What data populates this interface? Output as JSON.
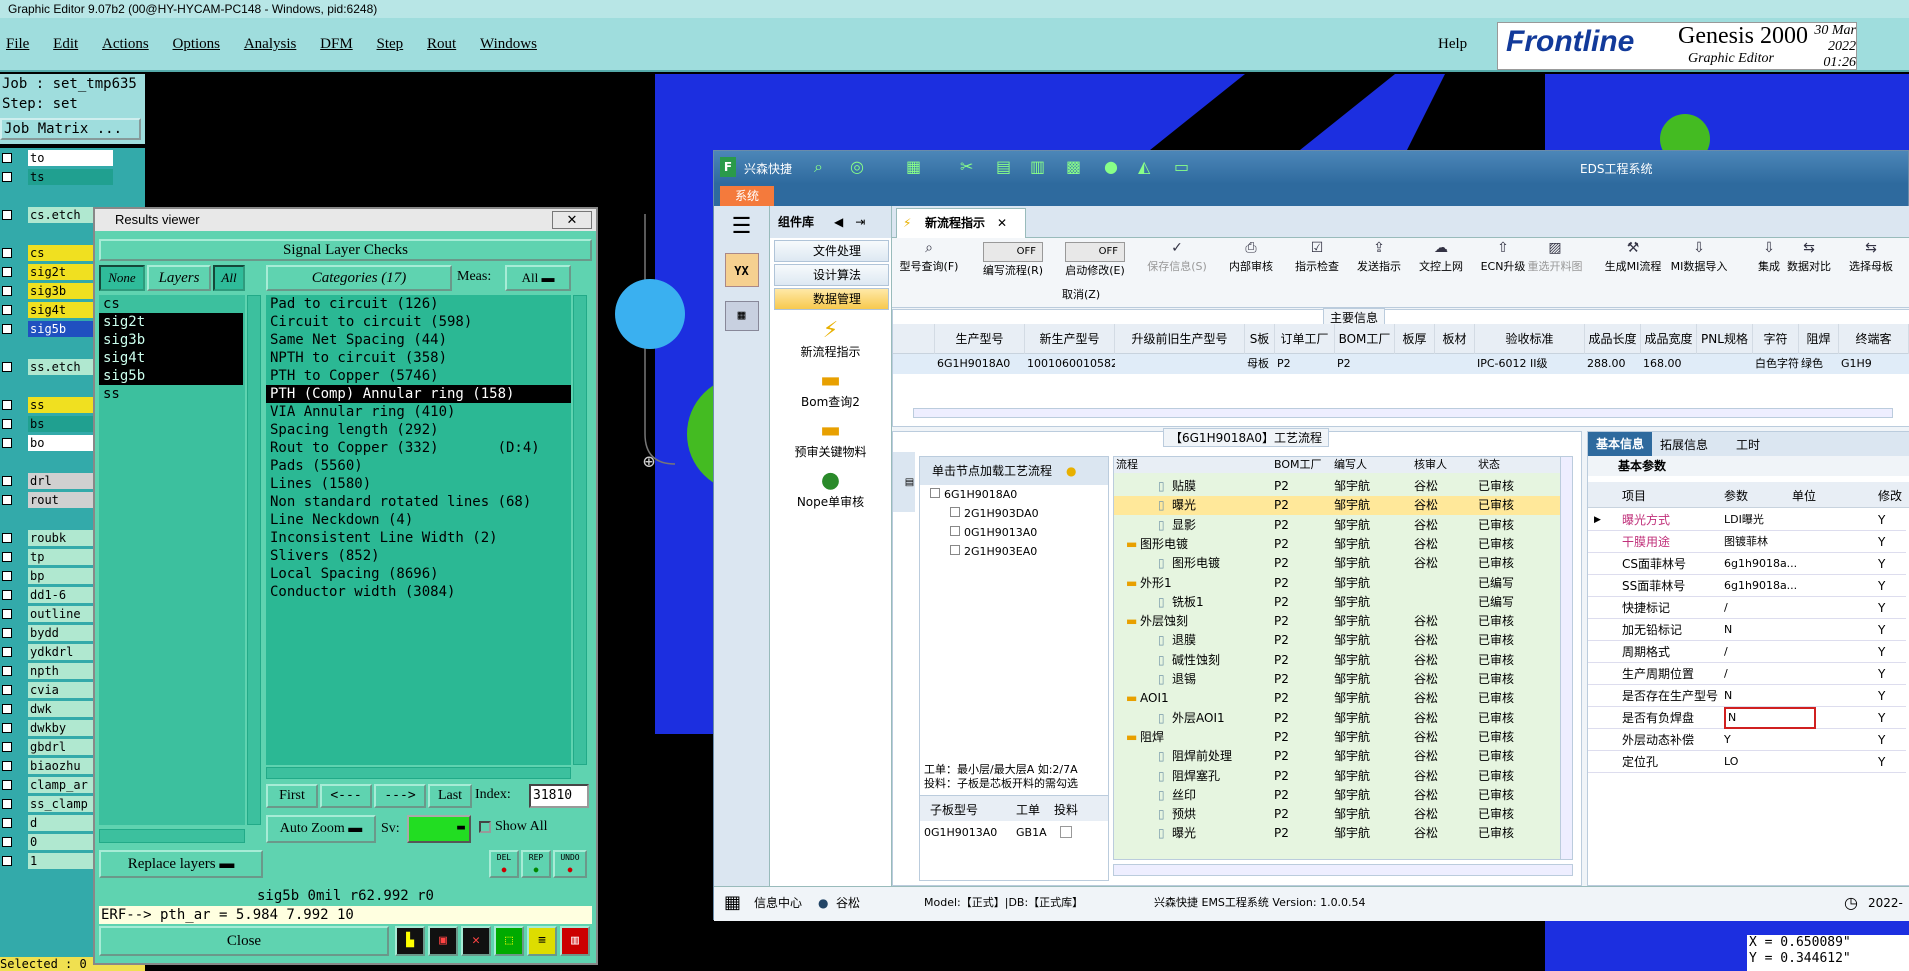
{
  "window_title": "Graphic Editor 9.07b2 (00@HY-HYCAM-PC148 - Windows, pid:6248)",
  "menu": [
    "File",
    "Edit",
    "Actions",
    "Options",
    "Analysis",
    "DFM",
    "Step",
    "Rout",
    "Windows"
  ],
  "help": "Help",
  "brand": {
    "logo": "Frontline",
    "product": "Genesis 2000",
    "subtitle": "Graphic Editor",
    "date": "30 Mar 2022",
    "time": "01:26 PM"
  },
  "job": {
    "job_line": "Job : set_tmp635",
    "step_line": "Step: set",
    "matrix_btn": "Job Matrix ..."
  },
  "layers": [
    {
      "name": "to",
      "bg": "#ffffff"
    },
    {
      "name": "ts",
      "bg": "#20a090"
    },
    {
      "name": "",
      "bg": ""
    },
    {
      "name": "cs.etch",
      "bg": "#b0e8d0"
    },
    {
      "name": "",
      "bg": ""
    },
    {
      "name": "cs",
      "bg": "#f0e020"
    },
    {
      "name": "sig2t",
      "bg": "#f0e020"
    },
    {
      "name": "sig3b",
      "bg": "#f0e020"
    },
    {
      "name": "sig4t",
      "bg": "#f0e020"
    },
    {
      "name": "sig5b",
      "bg": "#2050c0"
    },
    {
      "name": "",
      "bg": ""
    },
    {
      "name": "ss.etch",
      "bg": "#b0e8d0"
    },
    {
      "name": "",
      "bg": ""
    },
    {
      "name": "ss",
      "bg": "#f0e020"
    },
    {
      "name": "bs",
      "bg": "#20a090"
    },
    {
      "name": "bo",
      "bg": "#ffffff"
    },
    {
      "name": "",
      "bg": ""
    },
    {
      "name": "drl",
      "bg": "#d0d0d0"
    },
    {
      "name": "rout",
      "bg": "#d0d0d0"
    },
    {
      "name": "",
      "bg": ""
    },
    {
      "name": "roubk",
      "bg": "#b0e8d0"
    },
    {
      "name": "tp",
      "bg": "#b0e8d0"
    },
    {
      "name": "bp",
      "bg": "#b0e8d0"
    },
    {
      "name": "dd1-6",
      "bg": "#b0e8d0"
    },
    {
      "name": "outline",
      "bg": "#b0e8d0"
    },
    {
      "name": "bydd",
      "bg": "#b0e8d0"
    },
    {
      "name": "ydkdrl",
      "bg": "#b0e8d0"
    },
    {
      "name": "npth",
      "bg": "#b0e8d0"
    },
    {
      "name": "cvia",
      "bg": "#b0e8d0"
    },
    {
      "name": "dwk",
      "bg": "#b0e8d0"
    },
    {
      "name": "dwkby",
      "bg": "#b0e8d0"
    },
    {
      "name": "gbdrl",
      "bg": "#b0e8d0"
    },
    {
      "name": "biaozhu",
      "bg": "#b0e8d0"
    },
    {
      "name": "clamp_ar",
      "bg": "#b0e8d0"
    },
    {
      "name": "ss_clamp",
      "bg": "#b0e8d0"
    },
    {
      "name": "d",
      "bg": "#b0e8d0"
    },
    {
      "name": "0",
      "bg": "#b0e8d0"
    },
    {
      "name": "1",
      "bg": "#b0e8d0"
    }
  ],
  "selected_label": "Selected : 0",
  "results_viewer": {
    "title": "Results viewer",
    "heading": "Signal Layer Checks",
    "none_btn": "None",
    "layers_btn": "Layers",
    "all_btn": "All",
    "categories_btn": "Categories (17)",
    "meas_label": "Meas:",
    "meas_value": "All",
    "layer_items": [
      "cs",
      "sig2t",
      "sig3b",
      "sig4t",
      "sig5b",
      "ss"
    ],
    "categories": [
      "Pad to circuit (126)",
      "Circuit to circuit (598)",
      "Same Net Spacing (44)",
      "NPTH to circuit (358)",
      "PTH to Copper (5746)",
      "PTH (Comp) Annular ring (158)",
      "VIA Annular ring (410)",
      "Spacing length (292)",
      "Rout to Copper (332)       (D:4)",
      "Pads (5560)",
      "Lines (1580)",
      "Non standard rotated lines (68)",
      "Line Neckdown (4)",
      "Inconsistent Line Width (2)",
      "Slivers (852)",
      "Local Spacing (8696)",
      "Conductor width (3084)"
    ],
    "first": "First",
    "prev": "<---",
    "next": "--->",
    "last": "Last",
    "index_label": "Index:",
    "index_value": "31810",
    "auto_zoom": "Auto Zoom",
    "sv_label": "Sv:",
    "show_all": "Show All",
    "replace_layers": "Replace layers",
    "icon_labels": [
      "DEL",
      "REP",
      "UNDO"
    ],
    "bottom_text": "sig5b 0mil  r62.992  r0",
    "erf_text": "ERF--> pth_ar = 5.984 7.992 10",
    "close": "Close"
  },
  "eds": {
    "app_name": "兴森快捷",
    "window_title": "EDS工程系统",
    "system_tab": "系统",
    "comp_lib": "组件库",
    "comp_buttons": [
      "文件处理",
      "设计算法",
      "数据管理"
    ],
    "comp_tools": [
      "新流程指示",
      "Bom查询2",
      "预审关键物料",
      "Nope单审核"
    ],
    "active_tab": "新流程指示",
    "toolbar": [
      "型号查询(F)",
      "编写流程(R)",
      "启动修改(E)",
      "保存信息(S)",
      "内部审核",
      "指示检查",
      "发送指示",
      "文控上网",
      "ECN升级",
      "重选开料图",
      "生成MI流程",
      "MI数据导入",
      "集成",
      "数据对比",
      "选择母板"
    ],
    "toggle_off": "OFF",
    "cancel_label": "取消(Z)",
    "main_info_label": "主要信息",
    "main_cols": [
      "生产型号",
      "新生产型号",
      "升级前旧生产型号",
      "S板",
      "订单工厂",
      "BOM工厂",
      "板厚",
      "板材",
      "验收标准",
      "成品长度",
      "成品宽度",
      "PNL规格",
      "字符",
      "阻焊",
      "终端客"
    ],
    "main_row": [
      "6G1H9018A0",
      "10010600105823",
      "",
      "母板",
      "P2",
      "P2",
      "",
      "",
      "IPC-6012 II级",
      "288.00",
      "168.00",
      "",
      "白色字符",
      "绿色",
      "G1H9"
    ],
    "flow_label": "【6G1H9018A0】工艺流程",
    "node_hint": "单击节点加载工艺流程",
    "tree_nodes": [
      "6G1H9018A0",
      "2G1H903DA0",
      "0G1H9013A0",
      "2G1H903EA0"
    ],
    "work_note_1": "工单：最小层/最大层A 如:2/7A",
    "work_note_2": "投料：子板是芯板开料的需勾选",
    "sub_cols": [
      "子板型号",
      "工单",
      "投料"
    ],
    "sub_row": [
      "0G1H9013A0",
      "GB1A"
    ],
    "flow_cols": [
      "流程",
      "BOM工厂",
      "编写人",
      "核审人",
      "状态"
    ],
    "flow_rows": [
      {
        "n": "贴膜",
        "f": "P2",
        "w": "邹宇航",
        "r": "谷松",
        "s": "已审核",
        "lvl": 2
      },
      {
        "n": "曝光",
        "f": "P2",
        "w": "邹宇航",
        "r": "谷松",
        "s": "已审核",
        "lvl": 2,
        "sel": true
      },
      {
        "n": "显影",
        "f": "P2",
        "w": "邹宇航",
        "r": "谷松",
        "s": "已审核",
        "lvl": 2
      },
      {
        "n": "图形电镀",
        "f": "P2",
        "w": "邹宇航",
        "r": "谷松",
        "s": "已审核",
        "lvl": 1
      },
      {
        "n": "图形电镀",
        "f": "P2",
        "w": "邹宇航",
        "r": "谷松",
        "s": "已审核",
        "lvl": 2
      },
      {
        "n": "外形1",
        "f": "P2",
        "w": "邹宇航",
        "r": "",
        "s": "已编写",
        "lvl": 1
      },
      {
        "n": "铣板1",
        "f": "P2",
        "w": "邹宇航",
        "r": "",
        "s": "已编写",
        "lvl": 2
      },
      {
        "n": "外层蚀刻",
        "f": "P2",
        "w": "邹宇航",
        "r": "谷松",
        "s": "已审核",
        "lvl": 1
      },
      {
        "n": "退膜",
        "f": "P2",
        "w": "邹宇航",
        "r": "谷松",
        "s": "已审核",
        "lvl": 2
      },
      {
        "n": "碱性蚀刻",
        "f": "P2",
        "w": "邹宇航",
        "r": "谷松",
        "s": "已审核",
        "lvl": 2
      },
      {
        "n": "退锡",
        "f": "P2",
        "w": "邹宇航",
        "r": "谷松",
        "s": "已审核",
        "lvl": 2
      },
      {
        "n": "AOI1",
        "f": "P2",
        "w": "邹宇航",
        "r": "谷松",
        "s": "已审核",
        "lvl": 1
      },
      {
        "n": "外层AOI1",
        "f": "P2",
        "w": "邹宇航",
        "r": "谷松",
        "s": "已审核",
        "lvl": 2
      },
      {
        "n": "阻焊",
        "f": "P2",
        "w": "邹宇航",
        "r": "谷松",
        "s": "已审核",
        "lvl": 1
      },
      {
        "n": "阻焊前处理",
        "f": "P2",
        "w": "邹宇航",
        "r": "谷松",
        "s": "已审核",
        "lvl": 2
      },
      {
        "n": "阻焊塞孔",
        "f": "P2",
        "w": "邹宇航",
        "r": "谷松",
        "s": "已审核",
        "lvl": 2
      },
      {
        "n": "丝印",
        "f": "P2",
        "w": "邹宇航",
        "r": "谷松",
        "s": "已审核",
        "lvl": 2
      },
      {
        "n": "预烘",
        "f": "P2",
        "w": "邹宇航",
        "r": "谷松",
        "s": "已审核",
        "lvl": 2
      },
      {
        "n": "曝光",
        "f": "P2",
        "w": "邹宇航",
        "r": "谷松",
        "s": "已审核",
        "lvl": 2
      }
    ],
    "right_tabs": [
      "基本信息",
      "拓展信息",
      "工时"
    ],
    "basic_params": "基本参数",
    "prop_cols": [
      "项目",
      "参数",
      "单位",
      "修改"
    ],
    "props": [
      {
        "k": "曝光方式",
        "v": "LDI曝光",
        "u": "",
        "m": "Y",
        "color": "#c0307a"
      },
      {
        "k": "干膜用途",
        "v": "图镀菲林",
        "u": "",
        "m": "Y",
        "color": "#c0307a"
      },
      {
        "k": "CS面菲林号",
        "v": "6g1h9018a...",
        "u": "",
        "m": "Y",
        "color": ""
      },
      {
        "k": "SS面菲林号",
        "v": "6g1h9018a...",
        "u": "",
        "m": "Y",
        "color": ""
      },
      {
        "k": "快捷标记",
        "v": "/",
        "u": "",
        "m": "Y",
        "color": ""
      },
      {
        "k": "加无铅标记",
        "v": "N",
        "u": "",
        "m": "Y",
        "color": ""
      },
      {
        "k": "周期格式",
        "v": "/",
        "u": "",
        "m": "Y",
        "color": ""
      },
      {
        "k": "生产周期位置",
        "v": "/",
        "u": "",
        "m": "Y",
        "color": ""
      },
      {
        "k": "是否存在生产型号",
        "v": "N",
        "u": "",
        "m": "Y",
        "color": ""
      },
      {
        "k": "是否有负焊盘",
        "v": "N",
        "u": "",
        "m": "Y",
        "color": ""
      },
      {
        "k": "外层动态补偿",
        "v": "Y",
        "u": "",
        "m": "Y",
        "color": ""
      },
      {
        "k": "定位孔",
        "v": "LO",
        "u": "",
        "m": "Y",
        "color": ""
      }
    ],
    "status_info": "信息中心",
    "status_user": "谷松",
    "status_model": "Model:【正式】|DB:【正式库】",
    "status_version": "兴森快捷 EMS工程系统 Version: 1.0.0.54",
    "status_year": "2022-"
  },
  "coords": {
    "x": "X = 0.650089\"",
    "y": "Y = 0.344612\""
  }
}
